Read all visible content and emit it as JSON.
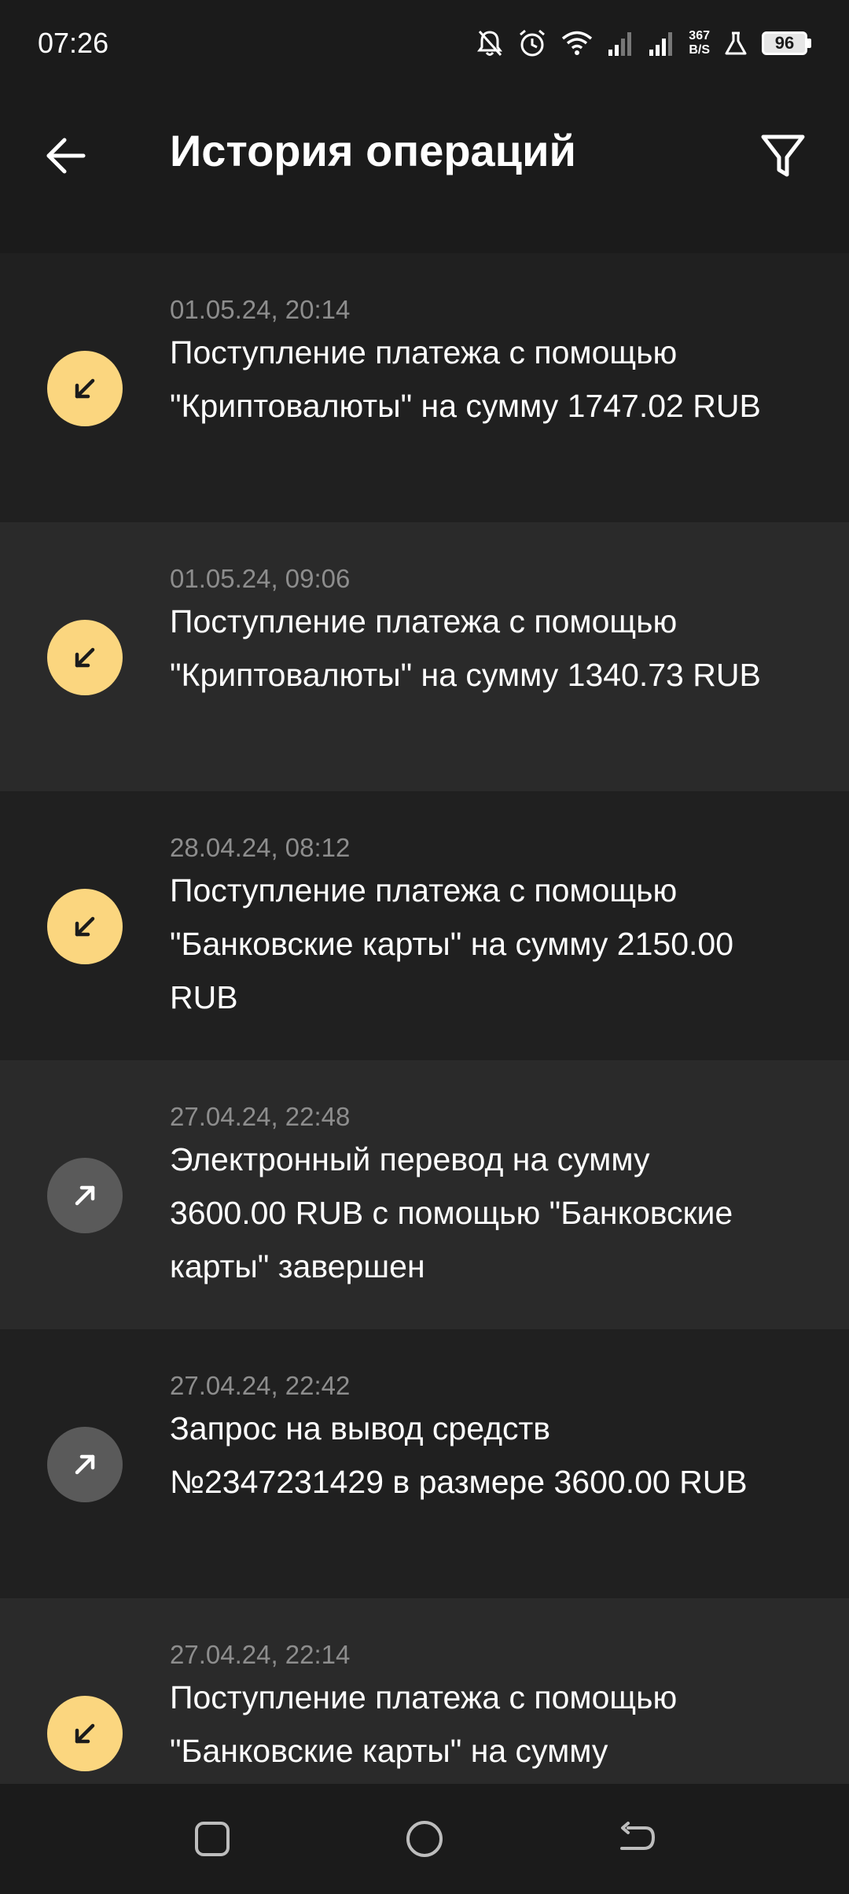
{
  "status_bar": {
    "time": "07:26",
    "net_speed_value": "367",
    "net_speed_unit": "B/S",
    "battery": "96",
    "icons": [
      "bell-off-icon",
      "alarm-icon",
      "wifi-icon",
      "signal-icon",
      "signal-icon",
      "lab-icon",
      "battery-icon"
    ]
  },
  "header": {
    "title": "История операций",
    "back_icon": "arrow-left-icon",
    "filter_icon": "filter-icon"
  },
  "colors": {
    "background": "#1b1b1b",
    "row_odd": "#202020",
    "row_even": "#2a2a2a",
    "incoming_icon_bg": "#fbd67f",
    "outgoing_icon_bg": "#5a5a5a",
    "date_text": "#8d8d8d"
  },
  "operations": [
    {
      "date": "01.05.24, 20:14",
      "text": "Поступление платежа с помощью \"Криптовалюты\" на сумму 1747.02 RUB",
      "direction": "incoming"
    },
    {
      "date": "01.05.24, 09:06",
      "text": "Поступление платежа с помощью \"Криптовалюты\" на сумму 1340.73 RUB",
      "direction": "incoming"
    },
    {
      "date": "28.04.24, 08:12",
      "text": "Поступление платежа с помощью \"Банковские карты\" на сумму 2150.00 RUB",
      "direction": "incoming"
    },
    {
      "date": "27.04.24, 22:48",
      "text": "Электронный перевод на сумму 3600.00 RUB с помощью \"Банковские карты\" завершен",
      "direction": "outgoing"
    },
    {
      "date": "27.04.24, 22:42",
      "text": "Запрос на вывод средств №2347231429 в размере 3600.00 RUB",
      "direction": "outgoing"
    },
    {
      "date": "27.04.24, 22:14",
      "text": "Поступление платежа с помощью \"Банковские карты\" на сумму",
      "direction": "incoming"
    }
  ],
  "nav_bar": {
    "recents_icon": "square-icon",
    "home_icon": "circle-icon",
    "back_icon": "back-arrow-icon"
  }
}
